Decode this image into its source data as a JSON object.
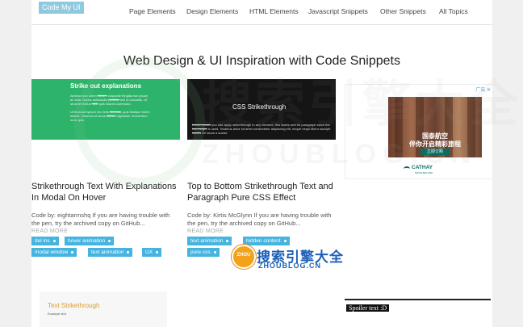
{
  "header": {
    "logo": "Code My UI",
    "nav": [
      "Page Elements",
      "Design Elements",
      "HTML Elements",
      "Javascript Snippets",
      "Other Snippets",
      "All Topics"
    ]
  },
  "page_title": "Web Design & UI Inspiration with Code Snippets",
  "cards": [
    {
      "thumb_title": "Strike out explanations",
      "title": "Strikethrough Text With Explanations In Modal On Hover",
      "code": "Code by: eightarmshq If you are having trouble with the pen, try the archived copy on GitHub...",
      "read_more": "READ MORE",
      "tags": [
        "del ins",
        "hover animation",
        "modal window",
        "text animation",
        "UX"
      ]
    },
    {
      "thumb_title": "CSS Strikethrough",
      "title": "Top to Bottom Strikethrough Text and Paragraph Pure CSS Effect",
      "code": "Code by: Kirtis McGlynn If you are having trouble with the pen, try the archived copy on GitHub...",
      "read_more": "READ MORE",
      "tags": [
        "text animation",
        "hidden content",
        "pure css"
      ]
    }
  ],
  "ad": {
    "badge": "广告 ✕",
    "headline_1": "国泰航空",
    "headline_2": "伴你开启精彩旅程",
    "cta": "立即订购",
    "brand": "CATHAY",
    "brand_sub": "MOVE BEYOND"
  },
  "bottom": {
    "thumb_title": "Text Strikethrough",
    "thumb_sub": "Example text",
    "spoiler": "Spoiler text :D"
  },
  "watermark": {
    "cn": "搜索引擎大全",
    "en": "ZHOUBLOG.CN",
    "badge": "ZHOU"
  },
  "colors": {
    "accent_tag": "#45b4e0",
    "logo_bg": "#8fc9df",
    "thumb_green": "#2db46a",
    "ad_brand": "#0c6d62"
  }
}
